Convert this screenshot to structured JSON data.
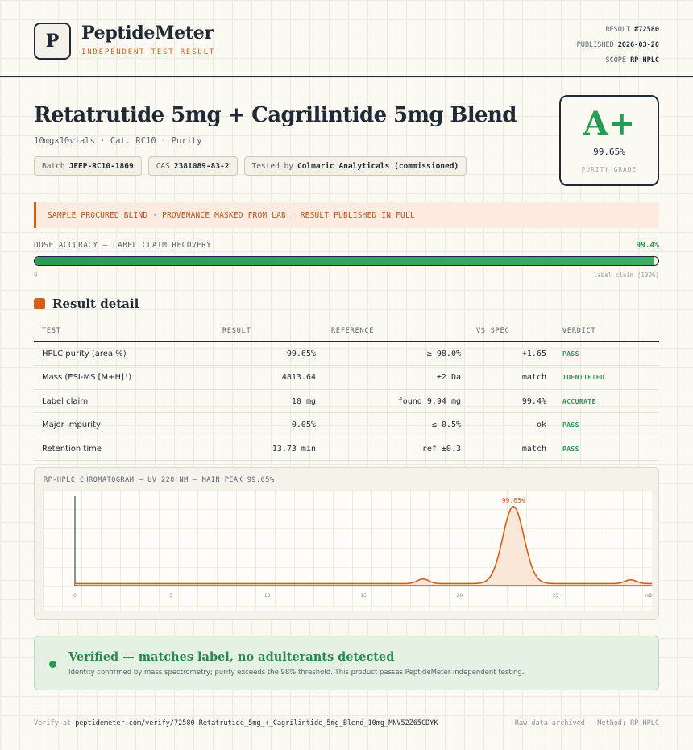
{
  "brand": {
    "logo_letter": "P",
    "name": "PeptideMeter",
    "tagline": "INDEPENDENT TEST RESULT"
  },
  "meta": {
    "result_label": "RESULT",
    "result_value": "#72580",
    "published_label": "PUBLISHED",
    "published_value": "2026-03-20",
    "scope_label": "SCOPE",
    "scope_value": "RP-HPLC"
  },
  "product": {
    "title": "Retatrutide 5mg + Cagrilintide 5mg Blend",
    "subtitle": "10mg×10vials · Cat. RC10 · Purity",
    "tags": {
      "batch_label": "Batch",
      "batch_value": "JEEP-RC10-1869",
      "cas_label": "CAS",
      "cas_value": "2381089-83-2",
      "tested_label": "Tested by",
      "tested_value": "Colmaric Analyticals (commissioned)"
    }
  },
  "grade": {
    "letter": "A+",
    "value": "99.65%",
    "label": "PURITY GRADE"
  },
  "banner": "SAMPLE PROCURED BLIND · PROVENANCE MASKED FROM LAB · RESULT PUBLISHED IN FULL",
  "dose": {
    "label": "DOSE ACCURACY — LABEL CLAIM RECOVERY",
    "value": "99.4%",
    "fraction": 0.994,
    "min_label": "0",
    "max_label": "label claim (100%)"
  },
  "result_detail": {
    "title": "Result detail",
    "headers": {
      "test": "TEST",
      "result": "RESULT",
      "reference": "REFERENCE",
      "vs_spec": "VS SPEC",
      "verdict": "VERDICT"
    },
    "rows": [
      {
        "test": "HPLC purity (area %)",
        "result": "99.65%",
        "reference": "≥ 98.0%",
        "vs_spec": "+1.65",
        "verdict": "PASS"
      },
      {
        "test": "Mass (ESI-MS [M+H]⁺)",
        "result": "4813.64",
        "reference": "±2 Da",
        "vs_spec": "match",
        "verdict": "IDENTIFIED"
      },
      {
        "test": "Label claim",
        "result": "10 mg",
        "reference": "found 9.94 mg",
        "vs_spec": "99.4%",
        "verdict": "ACCURATE"
      },
      {
        "test": "Major impurity",
        "result": "0.05%",
        "reference": "≤ 0.5%",
        "vs_spec": "ok",
        "verdict": "PASS"
      },
      {
        "test": "Retention time",
        "result": "13.73 min",
        "reference": "ref ±0.3",
        "vs_spec": "match",
        "verdict": "PASS"
      }
    ]
  },
  "chromatogram": {
    "title": "RP-HPLC CHROMATOGRAM — UV 220 NM — MAIN PEAK 99.65%",
    "peak_label": "99.65%",
    "line_color": "#d35f1b",
    "fill_color": "#fbe7d8",
    "x_ticks": [
      "0",
      "5",
      "10",
      "15",
      "20",
      "25",
      "30"
    ],
    "x_unit": "min",
    "x_max": 30,
    "baseline": 0.015,
    "peaks": [
      {
        "center": 18.1,
        "height": 0.055,
        "width": 0.3
      },
      {
        "center": 22.8,
        "height": 0.92,
        "width": 0.55
      },
      {
        "center": 28.9,
        "height": 0.045,
        "width": 0.3
      }
    ],
    "main_peak_x": 22.8
  },
  "verified": {
    "title": "Verified — matches label, no adulterants detected",
    "text": "Identity confirmed by mass spectrometry; purity exceeds the 98% threshold. This product passes PeptideMeter independent testing."
  },
  "footer": {
    "verify_label": "Verify at",
    "verify_url": "peptidemeter.com/verify/72580-Retatrutide_5mg_+_Cagrilintide_5mg_Blend_10mg_MNV52Z65CDYK",
    "right": "Raw data archived · Method: RP-HPLC"
  },
  "colors": {
    "accent": "#d35f1b",
    "pass": "#2a9a55",
    "ink": "#1f2a36"
  }
}
